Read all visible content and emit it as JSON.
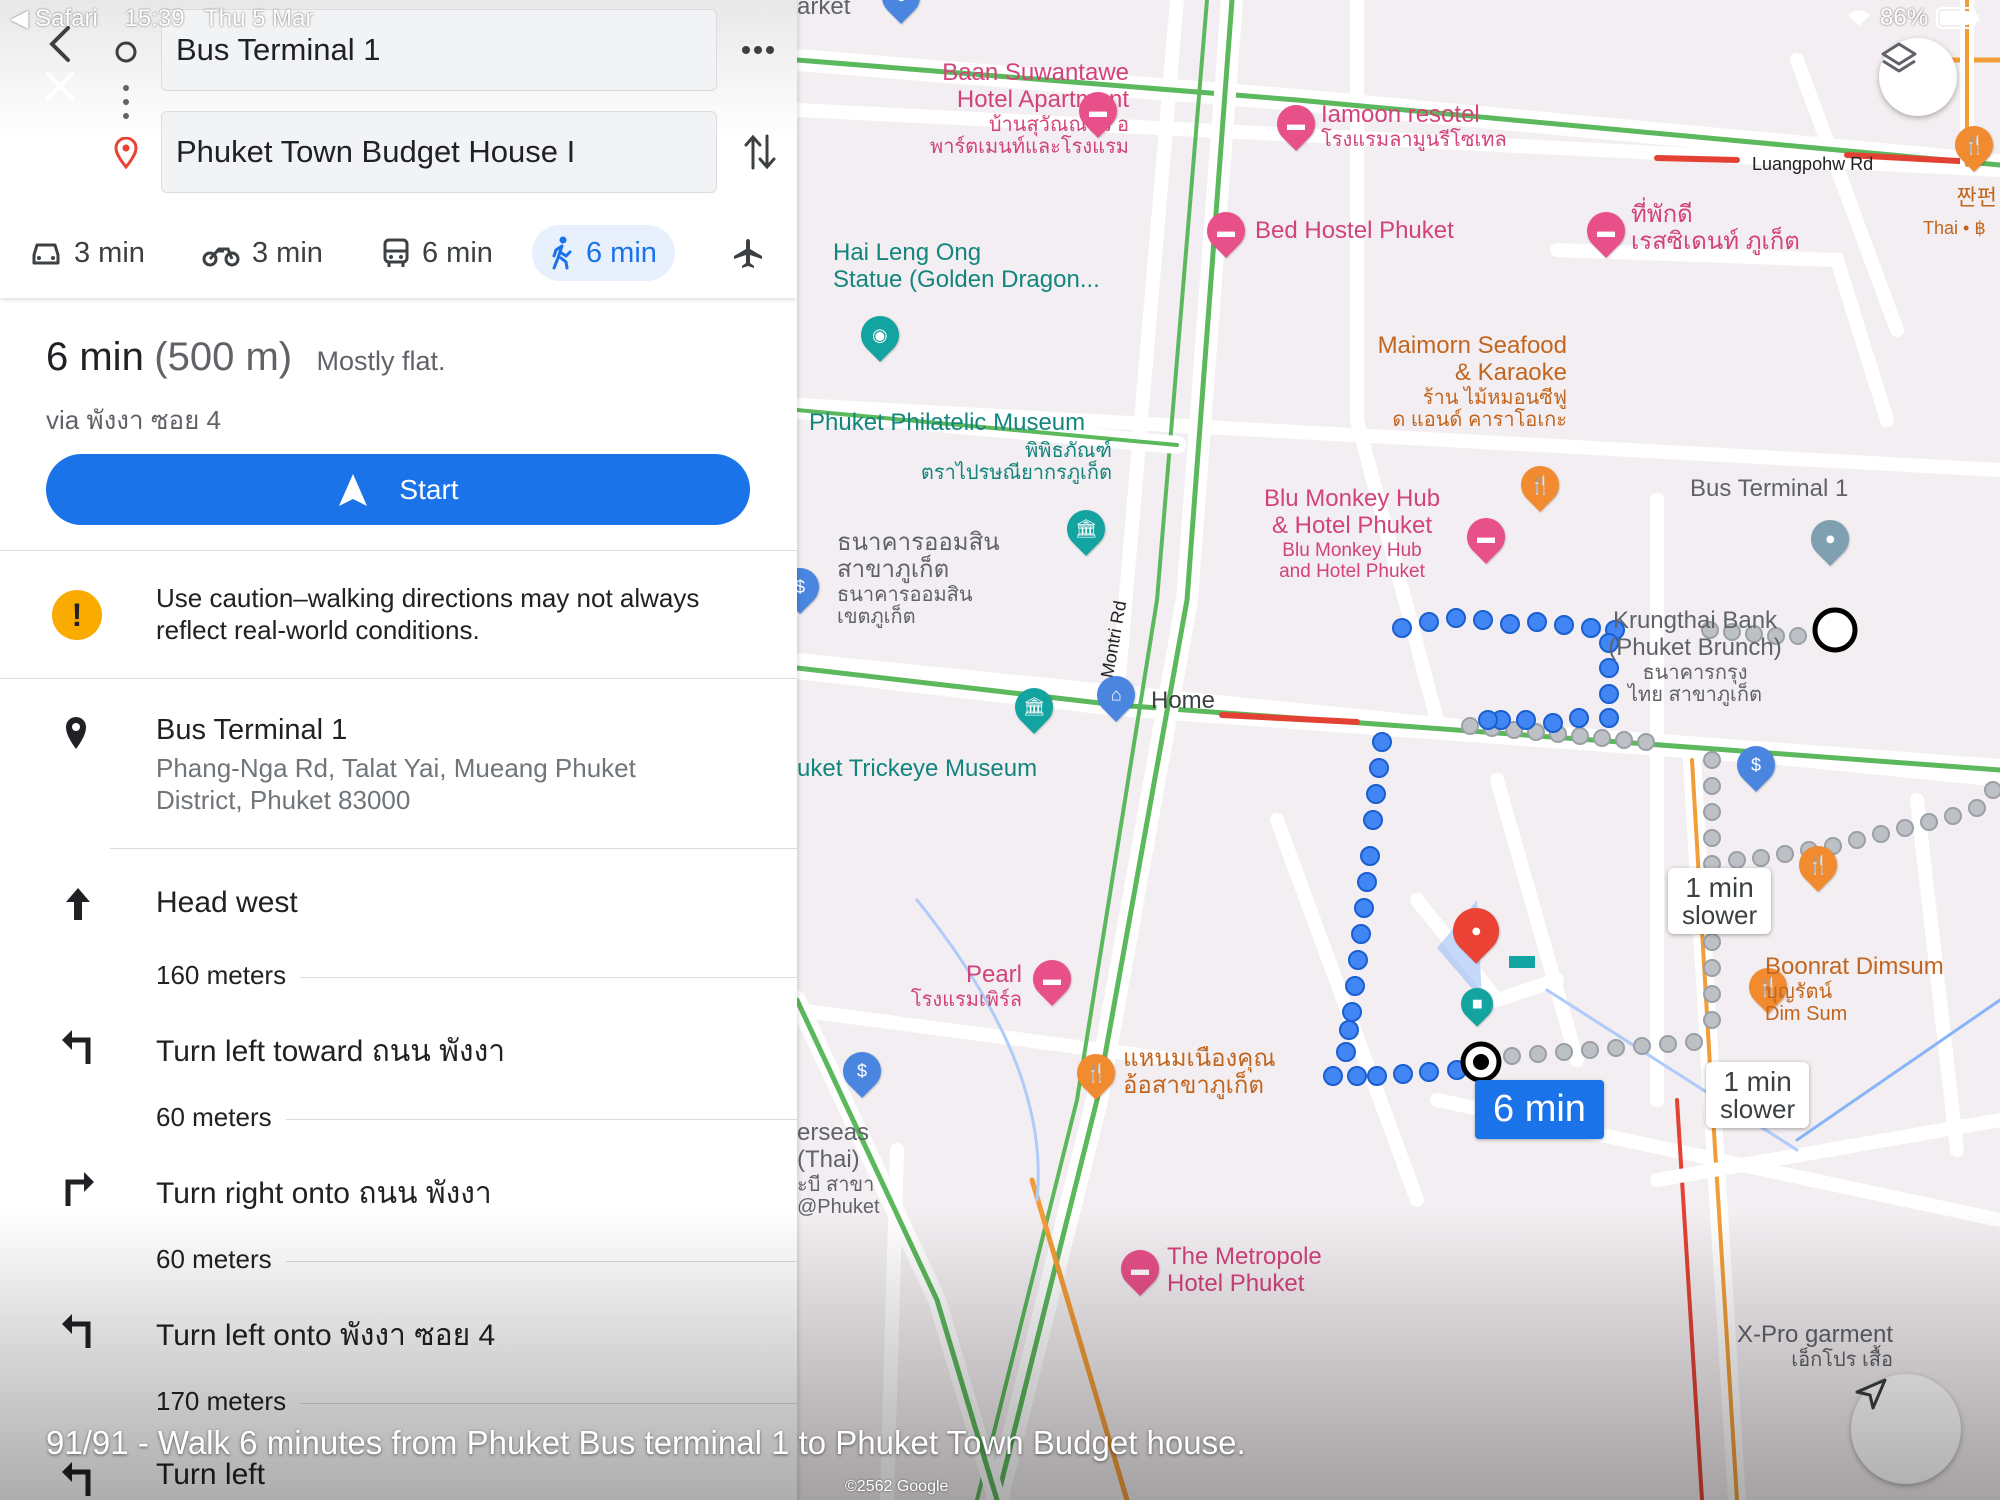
{
  "status_bar": {
    "back_app": "◀ Safari",
    "time": "15:39",
    "date": "Thu 5 Mar",
    "battery": "86%",
    "wifi_icon": "wifi-icon",
    "battery_icon": "battery-icon"
  },
  "search": {
    "origin": "Bus Terminal 1",
    "destination": "Phuket Town Budget House I"
  },
  "modes": [
    {
      "name": "drive",
      "icon": "car-icon",
      "time": "3 min"
    },
    {
      "name": "motorbike",
      "icon": "motorbike-icon",
      "time": "3 min"
    },
    {
      "name": "transit",
      "icon": "bus-icon",
      "time": "6 min"
    },
    {
      "name": "walk",
      "icon": "walk-icon",
      "time": "6 min",
      "active": true
    },
    {
      "name": "flight",
      "icon": "plane-icon",
      "time": ""
    }
  ],
  "route": {
    "duration": "6 min",
    "distance": "(500 m)",
    "terrain": "Mostly flat.",
    "via": "via พังงา ซอย 4",
    "start_label": "Start"
  },
  "warning": "Use caution–walking directions may not always reflect real-world conditions.",
  "origin_place": {
    "name": "Bus Terminal 1",
    "address": "Phang-Nga Rd, Talat Yai, Mueang Phuket District, Phuket 83000"
  },
  "steps": [
    {
      "instruction": "Head west",
      "distance": "160 meters",
      "icon": "arrow-up-icon"
    },
    {
      "instruction": "Turn left toward ถนน พังงา",
      "distance": "60 meters",
      "icon": "turn-left-icon"
    },
    {
      "instruction": "Turn right onto ถนน พังงา",
      "distance": "60 meters",
      "icon": "turn-right-icon"
    },
    {
      "instruction": "Turn left onto พังงา ซอย 4",
      "distance": "170 meters",
      "icon": "turn-left-icon"
    },
    {
      "instruction": "Turn left",
      "distance": "",
      "icon": "turn-left-icon"
    }
  ],
  "map": {
    "labels": {
      "arket": "arket",
      "baan1": "Baan Suwantawe",
      "baan2": "Hotel Apartment",
      "baan3": "บ้านสุวัณณ์ทวี อ",
      "baan4": "พาร์ตเมนท์และโรงแรม",
      "iamoon1": "Iamoon resotel",
      "iamoon2": "โรงแรมลามูนรีโซเทล",
      "luangpohw": "Luangpohw Rd",
      "korean1": "짠펀",
      "korean2": "Thai • ฿",
      "bedhostel": "Bed Hostel Phuket",
      "thipakdi1": "ที่พักดี",
      "thipakdi2": "เรสซิเดนท์ ภูเก็ต",
      "hailengong1": "Hai Leng Ong",
      "hailengong2": "Statue (Golden Dragon...",
      "maimorn1": "Maimorn Seafood",
      "maimorn2": "& Karaoke",
      "maimorn3": "ร้าน ไม้หมอนซีฟู",
      "maimorn4": "ด แอนด์ คาราโอเกะ",
      "philatelic1": "Phuket Philatelic Museum",
      "philatelic2": "พิพิธภัณฑ์",
      "philatelic3": "ตราไปรษณียากรภูเก็ต",
      "blumonkey1": "Blu Monkey Hub",
      "blumonkey2": "& Hotel Phuket",
      "blumonkey3": "Blu Monkey Hub",
      "blumonkey4": "and Hotel Phuket",
      "busterminal": "Bus Terminal 1",
      "gsb1": "ธนาคารออมสิน",
      "gsb2": "สาขาภูเก็ต",
      "gsb3": "ธนาคารออมสิน",
      "gsb4": "เขตภูเก็ต",
      "krungthai1": "Krungthai Bank",
      "krungthai2": "(Phuket Brunch)",
      "krungthai3": "ธนาคารกรุง",
      "krungthai4": "ไทย สาขาภูเก็ต",
      "montri": "Montri Rd",
      "home": "Home",
      "trickeye": "uket Trickeye Museum",
      "pearl1": "Pearl",
      "pearl2": "โรงแรมเพิร์ล",
      "boonrat1": "Boonrat Dimsum",
      "boonrat2": "บุญรัตน์",
      "boonrat3": "Dim Sum",
      "khanom1": "แหนมเนืองคุณ",
      "khanom2": "อ้อสาขาภูเก็ต",
      "overseas1": "erseas",
      "overseas2": "(Thai)",
      "overseas3": "ะบี สาขา",
      "overseas4": "@Phuket",
      "metropole1": "The Metropole",
      "metropole2": "Hotel Phuket",
      "xpro1": "X-Pro garment",
      "xpro2": "เอ็กโปร เสื้อ"
    },
    "route_time": "6 min",
    "alt1": {
      "line1": "1 min",
      "line2": "slower"
    },
    "alt2": {
      "line1": "1 min",
      "line2": "slower"
    },
    "copyright": "©2562 Google",
    "route_color": "#4285f4",
    "alt_route_color": "#9aa0a6"
  },
  "caption": "91/91 - Walk 6 minutes from Phuket Bus terminal 1 to Phuket Town Budget house."
}
